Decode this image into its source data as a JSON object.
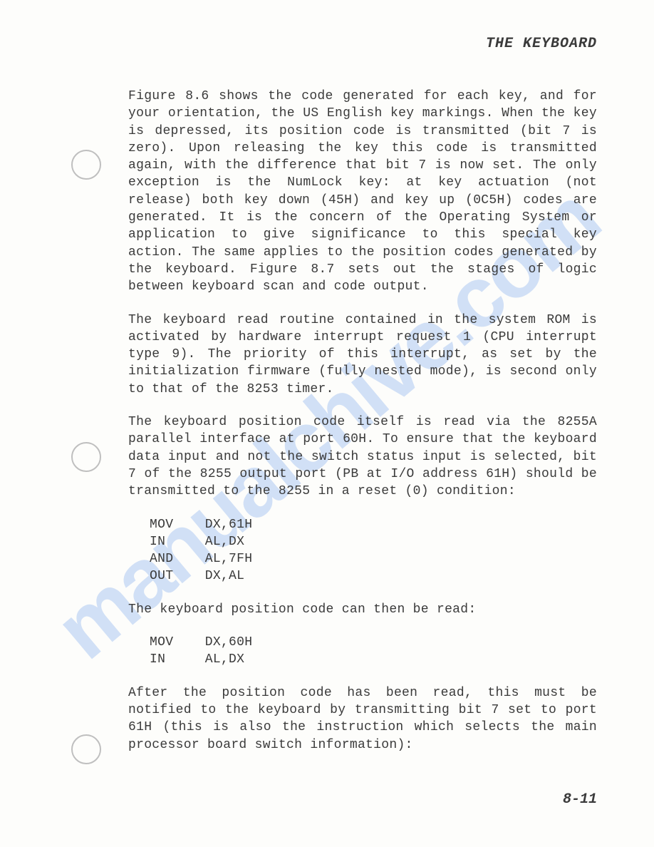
{
  "header": "THE KEYBOARD",
  "watermark": "manualchive.com",
  "paragraphs": {
    "p1": "Figure 8.6 shows the code generated for each key, and for your orientation, the US English key markings. When the key is depressed, its position code is transmitted (bit 7 is zero). Upon releasing the key this code is transmitted again, with the difference that bit 7 is now set. The only exception is the NumLock key: at key actuation (not release) both key down (45H) and key up (0C5H) codes are generated. It is the concern of the Operating System or application to give significance to this special key action. The same applies to the position codes generated by the keyboard. Figure 8.7 sets out the stages of logic between keyboard scan and code output.",
    "p2": "The keyboard read routine contained in the system ROM is activated by hardware interrupt request 1 (CPU interrupt type 9). The priority of this interrupt, as set by the initialization firmware (fully nested mode), is second only to that of the 8253 timer.",
    "p3": "The keyboard position code itself is read via the 8255A parallel interface at port 60H. To ensure that the keyboard data input and not the switch status input is selected, bit 7 of the 8255 output port (PB at I/O address 61H) should be transmitted to the 8255 in a reset (0) condition:",
    "code1": "MOV    DX,61H\nIN     AL,DX\nAND    AL,7FH\nOUT    DX,AL",
    "p4": "The keyboard position code can then be read:",
    "code2": "MOV    DX,60H\nIN     AL,DX",
    "p5": "After the position code has been read, this must be notified to the keyboard by transmitting bit 7 set to port 61H (this is also the instruction which selects the main processor board switch information):"
  },
  "pageNumber": "8-11"
}
